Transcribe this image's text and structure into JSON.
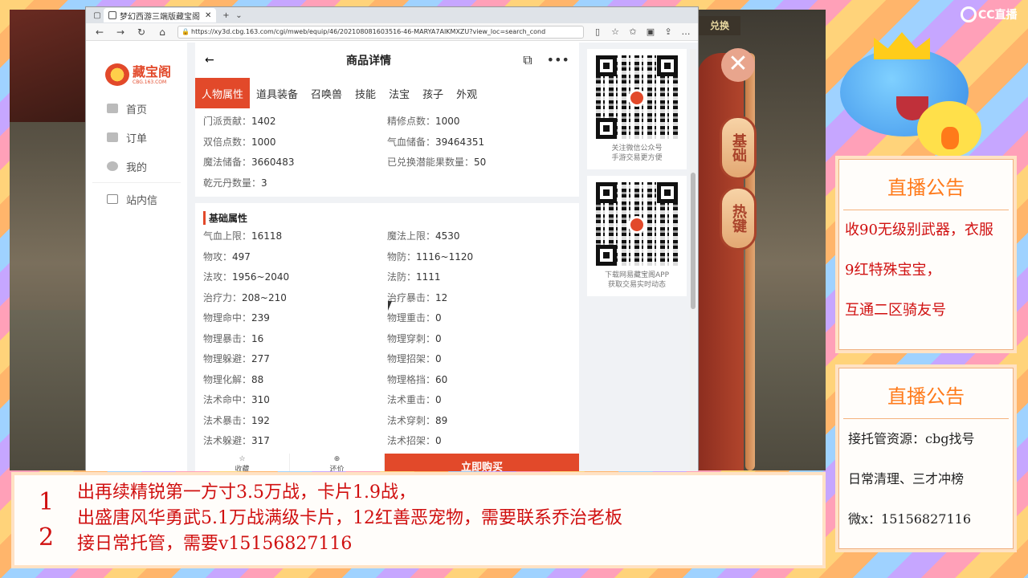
{
  "browser": {
    "tab_title": "梦幻西游三端版藏宝阁",
    "new_tab": "+",
    "url": "https://xy3d.cbg.163.com/cgi/mweb/equip/46/202108081603516-46-MARYA7AIKMXZU?view_loc=search_cond"
  },
  "sidebar": {
    "logo_text": "藏宝阁",
    "logo_sub": "CBG.163.COM",
    "items": [
      {
        "label": "首页",
        "icon": "home-icon"
      },
      {
        "label": "订单",
        "icon": "order-icon"
      },
      {
        "label": "我的",
        "icon": "user-icon"
      },
      {
        "label": "站内信",
        "icon": "mail-icon"
      }
    ]
  },
  "header": {
    "title": "商品详情"
  },
  "tabs": [
    "人物属性",
    "道具装备",
    "召唤兽",
    "技能",
    "法宝",
    "孩子",
    "外观"
  ],
  "top_attrs": [
    {
      "k": "门派贡献：",
      "v": "1402"
    },
    {
      "k": "精修点数：",
      "v": "1000"
    },
    {
      "k": "双倍点数：",
      "v": "1000"
    },
    {
      "k": "气血储备：",
      "v": "39464351"
    },
    {
      "k": "魔法储备：",
      "v": "3660483"
    },
    {
      "k": "已兑换潜能果数量：",
      "v": "50"
    },
    {
      "k": "乾元丹数量：",
      "v": "3"
    }
  ],
  "basic_title": "基础属性",
  "basic_attrs": [
    {
      "k": "气血上限：",
      "v": "16118"
    },
    {
      "k": "魔法上限：",
      "v": "4530"
    },
    {
      "k": "物攻：",
      "v": "497"
    },
    {
      "k": "物防：",
      "v": "1116~1120"
    },
    {
      "k": "法攻：",
      "v": "1956~2040"
    },
    {
      "k": "法防：",
      "v": "1111"
    },
    {
      "k": "治疗力：",
      "v": "208~210"
    },
    {
      "k": "治疗暴击：",
      "v": "12"
    },
    {
      "k": "物理命中：",
      "v": "239"
    },
    {
      "k": "物理重击：",
      "v": "0"
    },
    {
      "k": "物理暴击：",
      "v": "16"
    },
    {
      "k": "物理穿刺：",
      "v": "0"
    },
    {
      "k": "物理躲避：",
      "v": "277"
    },
    {
      "k": "物理招架：",
      "v": "0"
    },
    {
      "k": "物理化解：",
      "v": "88"
    },
    {
      "k": "物理格挡：",
      "v": "60"
    },
    {
      "k": "法术命中：",
      "v": "310"
    },
    {
      "k": "法术重击：",
      "v": "0"
    },
    {
      "k": "法术暴击：",
      "v": "192"
    },
    {
      "k": "法术穿刺：",
      "v": "89"
    },
    {
      "k": "法术躲避：",
      "v": "317"
    },
    {
      "k": "法术招架：",
      "v": "0"
    }
  ],
  "bottombar": {
    "fav": "收藏",
    "comment": "还价",
    "buy": "立即购买"
  },
  "qr": [
    {
      "line1": "关注微信公众号",
      "line2": "手游交易更方便"
    },
    {
      "line1": "下载网易藏宝阁APP",
      "line2": "获取交易实时动态"
    }
  ],
  "game": {
    "gold_label": "兑换",
    "btn_basic": "基础",
    "btn_hotkey": "热键"
  },
  "cc_logo": "CC直播",
  "notice1": {
    "title": "直播公告",
    "lines": [
      "收90无级别武器，衣服",
      "9红特殊宝宝，",
      "互通二区骑友号"
    ]
  },
  "notice2": {
    "title": "直播公告",
    "lines": [
      "接托管资源：cbg找号",
      "日常清理、三才冲榜",
      "微x：15156827116"
    ]
  },
  "caption": {
    "num1": "1",
    "num2": "2",
    "line1": "出再续精锐第一方寸3.5万战，卡片1.9战，",
    "line2": "出盛唐风华勇武5.1万战满级卡片，12红善恶宠物，需要联系乔治老板",
    "line3": "接日常托管，需要v15156827116"
  }
}
